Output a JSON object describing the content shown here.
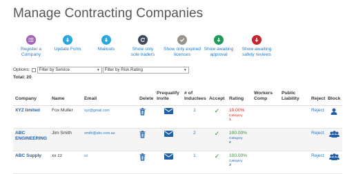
{
  "page": {
    "title": "Manage Contracting Companies"
  },
  "actions": [
    {
      "line1": "Register a",
      "line2": "Company",
      "icon": "list-icon",
      "color": "#a262b8"
    },
    {
      "line1": "Update Form",
      "line2": "",
      "icon": "download-arrow-icon",
      "color": "#29a8e0"
    },
    {
      "line1": "Mailouts",
      "line2": "",
      "icon": "download-arrow-icon",
      "color": "#29a8e0"
    },
    {
      "line1": "Show only",
      "line2": "sole traders",
      "icon": "refresh-icon",
      "color": "#3d4a5c"
    },
    {
      "line1": "Show only expired",
      "line2": "licences",
      "icon": "checkmark-icon",
      "color": "#9a948a"
    },
    {
      "line1": "Show awaiting",
      "line2": "approval",
      "icon": "download-arrow-icon",
      "color": "#1f9a5a"
    },
    {
      "line1": "Show awaiting",
      "line2": "safety reviews",
      "icon": "download-arrow-icon",
      "color": "#c0282e"
    }
  ],
  "filters": {
    "options_label": "Options:",
    "service": {
      "selected": "Filter by Service"
    },
    "risk": {
      "selected": "Filter by Risk Rating"
    }
  },
  "total": {
    "label": "Total: 20"
  },
  "table": {
    "headers": {
      "company": "Company",
      "name": "Name",
      "email": "Email",
      "delete": "Delete",
      "prequalify_1": "Prequalify",
      "prequalify_2": "Invite",
      "inductees_1": "# of",
      "inductees_2": "Inductees",
      "accept": "Accept",
      "rating": "Rating",
      "workers_1": "Workers",
      "workers_2": "Comp",
      "public_1": "Public",
      "public_2": "Liability",
      "reject": "Reject",
      "block": "Block"
    },
    "rows": [
      {
        "company_1": "XYZ limited",
        "company_2": "",
        "name": "Fox Muller",
        "email": "xyz@gmail.com",
        "inductees": "1",
        "accept": "✓",
        "rating_value": "10.00%",
        "rating_category": "Category",
        "rating_number": "1",
        "rating_color": "red",
        "reject": "Reject",
        "block_icon": "person-icon"
      },
      {
        "company_1": "ABC",
        "company_2": "ENGINEERING",
        "name": "Jim Smith",
        "email": "smith@abc.com.au",
        "inductees": "2",
        "accept": "✓",
        "rating_value": "100.00%",
        "rating_category": "Category",
        "rating_number": "2",
        "rating_color": "green",
        "reject": "Reject",
        "block_icon": "group-icon"
      },
      {
        "company_1": "ABC Supply",
        "company_2": "",
        "name": "xx zz",
        "email": "xz",
        "inductees": "1",
        "accept": "✓",
        "rating_value": "100.00%",
        "rating_category": "Category",
        "rating_number": "3",
        "rating_color": "green",
        "reject": "Reject",
        "block_icon": "group-icon"
      }
    ]
  }
}
